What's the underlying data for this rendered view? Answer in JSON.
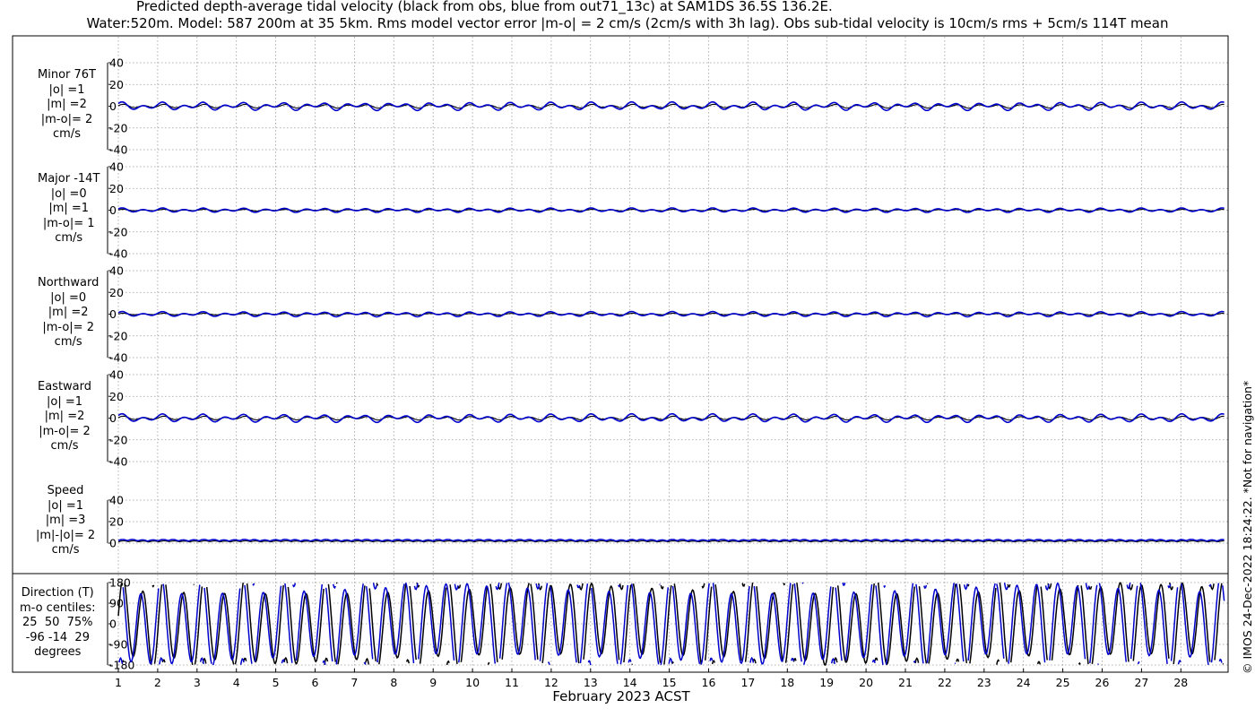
{
  "title": {
    "line1": "Predicted depth-average tidal velocity (black from obs, blue from out71_13c) at SAM1DS 36.5S 136.2E.",
    "line2": "Water:520m. Model: 587 200m at 35 5km. Rms model vector error |m-o| = 2 cm/s (2cm/s with 3h lag). Obs sub-tidal velocity is 10cm/s rms + 5cm/s 114T mean"
  },
  "copyright": "© IMOS 24-Dec-2022 18:24:22.  *Not for navigation*",
  "colors": {
    "obs": "#000000",
    "model": "#0000cc",
    "grid": "#9a9a9a"
  },
  "chart_data": {
    "type": "line",
    "x_axis": {
      "label": "February 2023 ACST",
      "ticks": [
        "1",
        "2",
        "3",
        "4",
        "5",
        "6",
        "7",
        "8",
        "9",
        "10",
        "11",
        "12",
        "13",
        "14",
        "15",
        "16",
        "17",
        "18",
        "19",
        "20",
        "21",
        "22",
        "23",
        "24",
        "25",
        "26",
        "27",
        "28"
      ],
      "range_days": [
        0.0,
        28.1
      ],
      "grid": true
    },
    "series_legend": {
      "obs": "black from obs",
      "model": "blue from out71_13c"
    },
    "panels": [
      {
        "id": "minor",
        "label_lines": [
          "Minor 76T",
          "|o| =1",
          "|m| =2",
          "|m-o|= 2",
          "cm/s"
        ],
        "yticks": [
          "40",
          "20",
          "0",
          "-20",
          "-40"
        ],
        "ylim": [
          -40,
          40
        ],
        "obs": {
          "amp": 1.2,
          "diurnal": 0.6,
          "mean": 0
        },
        "model": {
          "amp": 2.2,
          "diurnal": 1.8,
          "mean": 0
        }
      },
      {
        "id": "major",
        "label_lines": [
          "Major -14T",
          "|o| =0",
          "|m| =1",
          "|m-o|= 1",
          "cm/s"
        ],
        "yticks": [
          "40",
          "20",
          "0",
          "-20",
          "-40"
        ],
        "ylim": [
          -40,
          40
        ],
        "obs": {
          "amp": 0.5,
          "diurnal": 0.3,
          "mean": 0
        },
        "model": {
          "amp": 1.3,
          "diurnal": 0.8,
          "mean": 0
        }
      },
      {
        "id": "northward",
        "label_lines": [
          "Northward",
          "|o| =0",
          "|m| =2",
          "|m-o|= 2",
          "cm/s"
        ],
        "yticks": [
          "40",
          "20",
          "0",
          "-20",
          "-40"
        ],
        "ylim": [
          -40,
          40
        ],
        "obs": {
          "amp": 0.5,
          "diurnal": 0.3,
          "mean": 0
        },
        "model": {
          "amp": 1.4,
          "diurnal": 1.0,
          "mean": 0
        }
      },
      {
        "id": "eastward",
        "label_lines": [
          "Eastward",
          "|o| =1",
          "|m| =2",
          "|m-o|= 2",
          "cm/s"
        ],
        "yticks": [
          "40",
          "20",
          "0",
          "-20",
          "-40"
        ],
        "ylim": [
          -40,
          40
        ],
        "obs": {
          "amp": 1.2,
          "diurnal": 0.6,
          "mean": 0
        },
        "model": {
          "amp": 2.2,
          "diurnal": 1.8,
          "mean": 0
        }
      },
      {
        "id": "speed",
        "label_lines": [
          "Speed",
          "|o| =1",
          "|m| =3",
          "|m|-|o|= 2",
          "cm/s"
        ],
        "yticks": [
          "40",
          "20",
          "0"
        ],
        "ylim": [
          0,
          40
        ],
        "obs": {
          "amp": 0.8,
          "diurnal": 0.4,
          "mean": 1.2
        },
        "model": {
          "amp": 1.2,
          "diurnal": 0.8,
          "mean": 2.0
        }
      },
      {
        "id": "direction",
        "label_lines": [
          "Direction (T)",
          "m-o centiles:",
          "25  50  75%",
          "-96 -14  29",
          "degrees"
        ],
        "yticks": [
          "180",
          "90",
          "0",
          "-90",
          "-180"
        ],
        "ylim": [
          -180,
          180
        ]
      }
    ]
  }
}
